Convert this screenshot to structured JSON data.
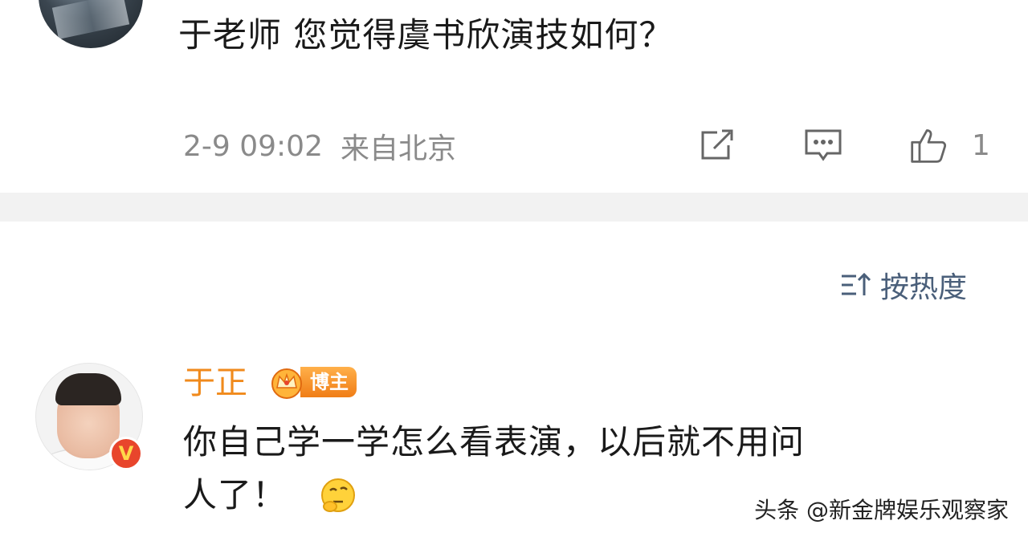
{
  "post": {
    "question": "于老师 您觉得虞书欣演技如何？",
    "date": "2-9 09:02",
    "location": "来自北京",
    "like_count": "1",
    "icons": [
      "edit-icon",
      "comment-icon",
      "like-icon"
    ]
  },
  "sort": {
    "label": "按热度",
    "icon": "sort-icon"
  },
  "reply": {
    "username": "于正",
    "badge_label": "博主",
    "verified_mark": "V",
    "line1": "你自己学一学怎么看表演，以后就不用问",
    "line2": "人了！",
    "emoji": "thinking-emoji"
  },
  "watermark": "头条 @新金牌娱乐观察家",
  "colors": {
    "username": "#f08a1c",
    "meta": "#8a8a8a",
    "sort": "#4a5f7a",
    "divider": "#f2f2f2",
    "verified": "#e8452c"
  }
}
